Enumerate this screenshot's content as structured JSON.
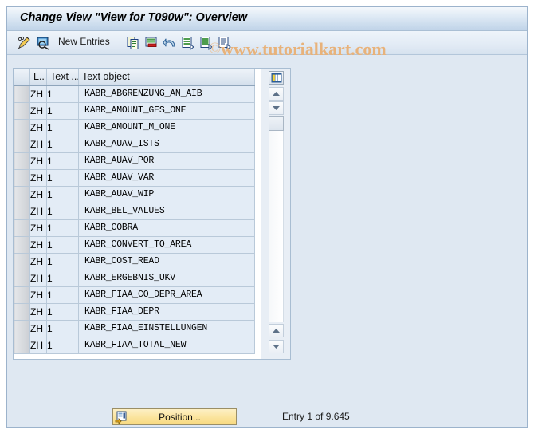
{
  "window": {
    "title": "Change View \"View for T090w\": Overview"
  },
  "watermark": {
    "text": "www.tutorialkart.com",
    "copyright": "©",
    "color": "#e8b27a"
  },
  "toolbar": {
    "new_entries_label": "New Entries",
    "icons": [
      {
        "name": "change-display-icon",
        "title": "Display/Change"
      },
      {
        "name": "select-layout-icon",
        "title": "Select Layout"
      },
      {
        "name": "copy-as-icon",
        "title": "Copy As..."
      },
      {
        "name": "delete-icon",
        "title": "Delete"
      },
      {
        "name": "undo-icon",
        "title": "Undo Change"
      },
      {
        "name": "select-all-icon",
        "title": "Select All"
      },
      {
        "name": "deselect-all-icon",
        "title": "Deselect All"
      },
      {
        "name": "details-icon",
        "title": "Details"
      }
    ]
  },
  "table": {
    "columns": [
      "",
      "L..",
      "Text ...",
      "Text object"
    ],
    "config_icon": "table-settings-icon",
    "rows": [
      {
        "lang": "ZH",
        "text_no": "1",
        "text_object": "KABR_ABGRENZUNG_AN_AIB"
      },
      {
        "lang": "ZH",
        "text_no": "1",
        "text_object": "KABR_AMOUNT_GES_ONE"
      },
      {
        "lang": "ZH",
        "text_no": "1",
        "text_object": "KABR_AMOUNT_M_ONE"
      },
      {
        "lang": "ZH",
        "text_no": "1",
        "text_object": "KABR_AUAV_ISTS"
      },
      {
        "lang": "ZH",
        "text_no": "1",
        "text_object": "KABR_AUAV_POR"
      },
      {
        "lang": "ZH",
        "text_no": "1",
        "text_object": "KABR_AUAV_VAR"
      },
      {
        "lang": "ZH",
        "text_no": "1",
        "text_object": "KABR_AUAV_WIP"
      },
      {
        "lang": "ZH",
        "text_no": "1",
        "text_object": "KABR_BEL_VALUES"
      },
      {
        "lang": "ZH",
        "text_no": "1",
        "text_object": "KABR_COBRA"
      },
      {
        "lang": "ZH",
        "text_no": "1",
        "text_object": "KABR_CONVERT_TO_AREA"
      },
      {
        "lang": "ZH",
        "text_no": "1",
        "text_object": "KABR_COST_READ"
      },
      {
        "lang": "ZH",
        "text_no": "1",
        "text_object": "KABR_ERGEBNIS_UKV"
      },
      {
        "lang": "ZH",
        "text_no": "1",
        "text_object": "KABR_FIAA_CO_DEPR_AREA"
      },
      {
        "lang": "ZH",
        "text_no": "1",
        "text_object": "KABR_FIAA_DEPR"
      },
      {
        "lang": "ZH",
        "text_no": "1",
        "text_object": "KABR_FIAA_EINSTELLUNGEN"
      },
      {
        "lang": "ZH",
        "text_no": "1",
        "text_object": "KABR_FIAA_TOTAL_NEW"
      }
    ]
  },
  "footer": {
    "position_label": "Position...",
    "position_icon": "position-icon",
    "entry_status": "Entry 1 of 9.645"
  }
}
